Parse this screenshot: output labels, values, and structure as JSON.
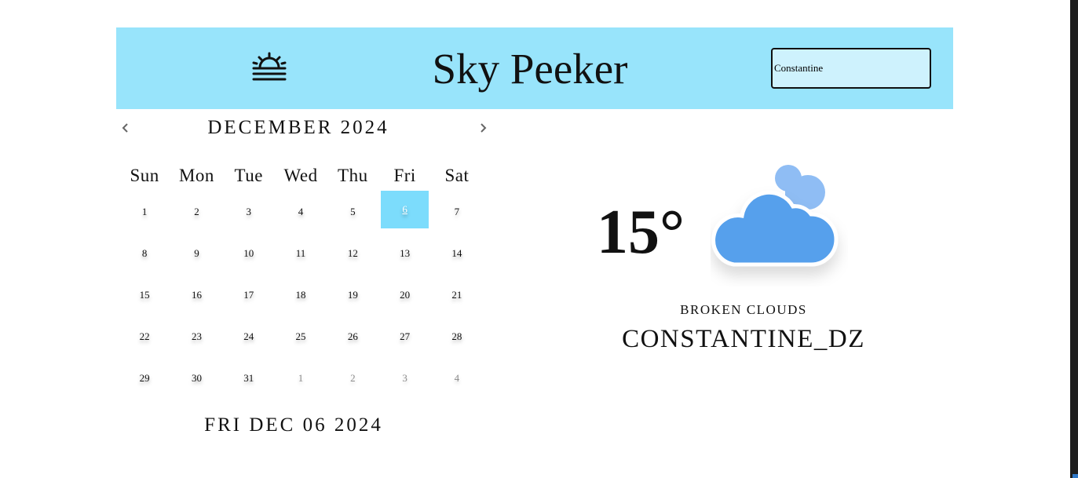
{
  "app": {
    "title": "Sky Peeker",
    "logo_icon": "sunrise-icon"
  },
  "search": {
    "value": "Constantine",
    "placeholder": ""
  },
  "calendar": {
    "month_label": "DECEMBER 2024",
    "prev_icon": "chevron-left-icon",
    "next_icon": "chevron-right-icon",
    "weekdays": [
      "Sun",
      "Mon",
      "Tue",
      "Wed",
      "Thu",
      "Fri",
      "Sat"
    ],
    "days": [
      {
        "label": "1",
        "muted": false
      },
      {
        "label": "2",
        "muted": false
      },
      {
        "label": "3",
        "muted": false
      },
      {
        "label": "4",
        "muted": false
      },
      {
        "label": "5",
        "muted": false
      },
      {
        "label": "6",
        "muted": false,
        "selected": true
      },
      {
        "label": "7",
        "muted": false
      },
      {
        "label": "8",
        "muted": false
      },
      {
        "label": "9",
        "muted": false
      },
      {
        "label": "10",
        "muted": false
      },
      {
        "label": "11",
        "muted": false
      },
      {
        "label": "12",
        "muted": false
      },
      {
        "label": "13",
        "muted": false
      },
      {
        "label": "14",
        "muted": false
      },
      {
        "label": "15",
        "muted": false
      },
      {
        "label": "16",
        "muted": false
      },
      {
        "label": "17",
        "muted": false
      },
      {
        "label": "18",
        "muted": false
      },
      {
        "label": "19",
        "muted": false
      },
      {
        "label": "20",
        "muted": false
      },
      {
        "label": "21",
        "muted": false
      },
      {
        "label": "22",
        "muted": false
      },
      {
        "label": "23",
        "muted": false
      },
      {
        "label": "24",
        "muted": false
      },
      {
        "label": "25",
        "muted": false
      },
      {
        "label": "26",
        "muted": false
      },
      {
        "label": "27",
        "muted": false
      },
      {
        "label": "28",
        "muted": false
      },
      {
        "label": "29",
        "muted": false
      },
      {
        "label": "30",
        "muted": false
      },
      {
        "label": "31",
        "muted": false
      },
      {
        "label": "1",
        "muted": true
      },
      {
        "label": "2",
        "muted": true
      },
      {
        "label": "3",
        "muted": true
      },
      {
        "label": "4",
        "muted": true
      }
    ],
    "selected_date": "FRI DEC 06 2024"
  },
  "weather": {
    "temperature": "15°",
    "condition": "BROKEN CLOUDS",
    "city": "CONSTANTINE_DZ",
    "icon": "broken-clouds-icon"
  },
  "colors": {
    "header_bg": "#98e4fb",
    "search_bg": "#cef2fd",
    "selected_day_bg": "#7cdcfc",
    "cloud_front": "#57a0ec",
    "cloud_back": "#8fbdf4"
  }
}
